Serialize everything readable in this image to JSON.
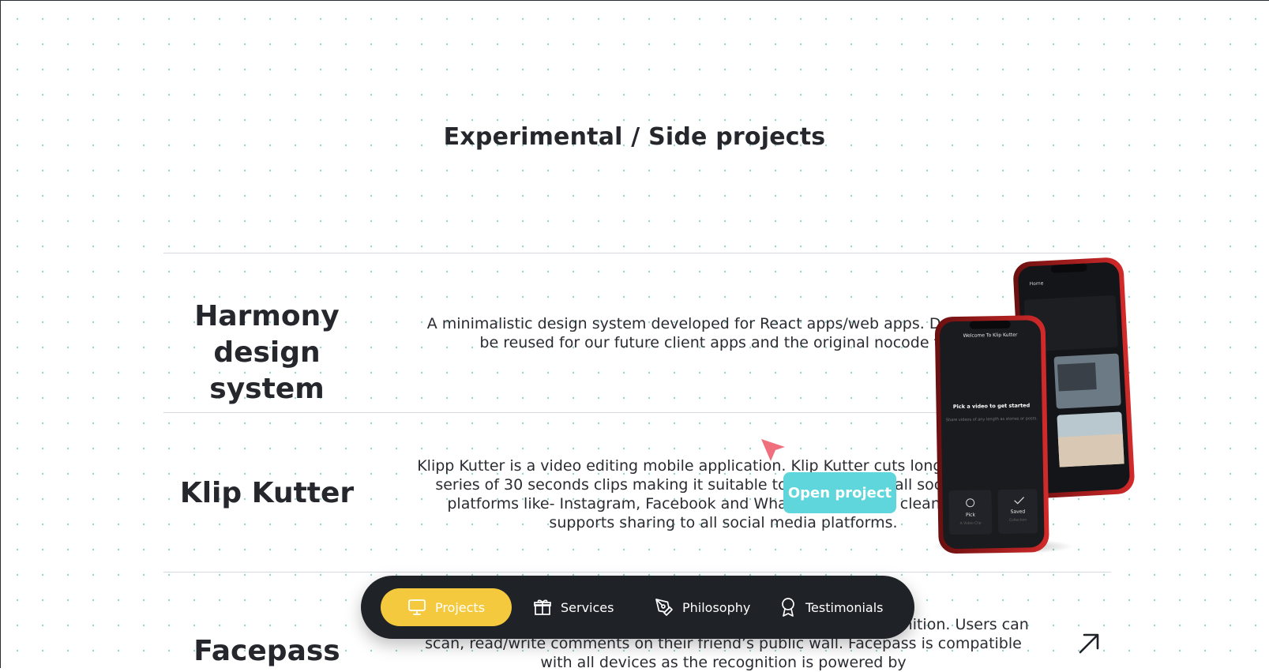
{
  "section": {
    "title": "Experimental / Side projects"
  },
  "projects": [
    {
      "name": "Harmony\ndesign system",
      "description": "A minimalistic design system developed for React apps/web apps. Designed to be reused for our future client apps and the original nocode tool."
    },
    {
      "name": "Klip Kutter",
      "description": "Klipp Kutter is a video editing mobile application. Klip Kutter cuts long videos into series of 30 seconds clips making it suitable to be shared on all social media platforms like- Instagram, Facebook and WhatsApp. It has a clean UX and supports sharing to all social media platforms."
    },
    {
      "name": "Facepass",
      "description": "Facepass lets users share messages to friends using facial recognition. Users can scan, read/write comments on their friend’s public wall. Facepass is compatible with all devices as the recognition is powered by"
    }
  ],
  "hover": {
    "open_label": "Open project"
  },
  "phone_mockup": {
    "back_screen_title": "Home",
    "front_screen_title": "Welcome To Klip Kutter",
    "prompt_title": "Pick a video to get started",
    "prompt_body": "Share videos of any length as stories or posts.",
    "tab_pick": "Pick",
    "tab_pick_sub": "A Video Clip",
    "tab_saved": "Saved",
    "tab_saved_sub": "Collection"
  },
  "nav": {
    "items": [
      {
        "label": "Projects",
        "icon": "monitor-icon",
        "active": true
      },
      {
        "label": "Services",
        "icon": "gift-icon",
        "active": false
      },
      {
        "label": "Philosophy",
        "icon": "pen-tool-icon",
        "active": false
      },
      {
        "label": "Testimonials",
        "icon": "award-icon",
        "active": false
      }
    ]
  },
  "colors": {
    "accent_yellow": "#f4c93d",
    "accent_cyan": "#5ed6dc",
    "nav_bg": "#1f2227",
    "cursor_red": "#ef6f7d",
    "dot_grid": "#8fd6cf"
  }
}
